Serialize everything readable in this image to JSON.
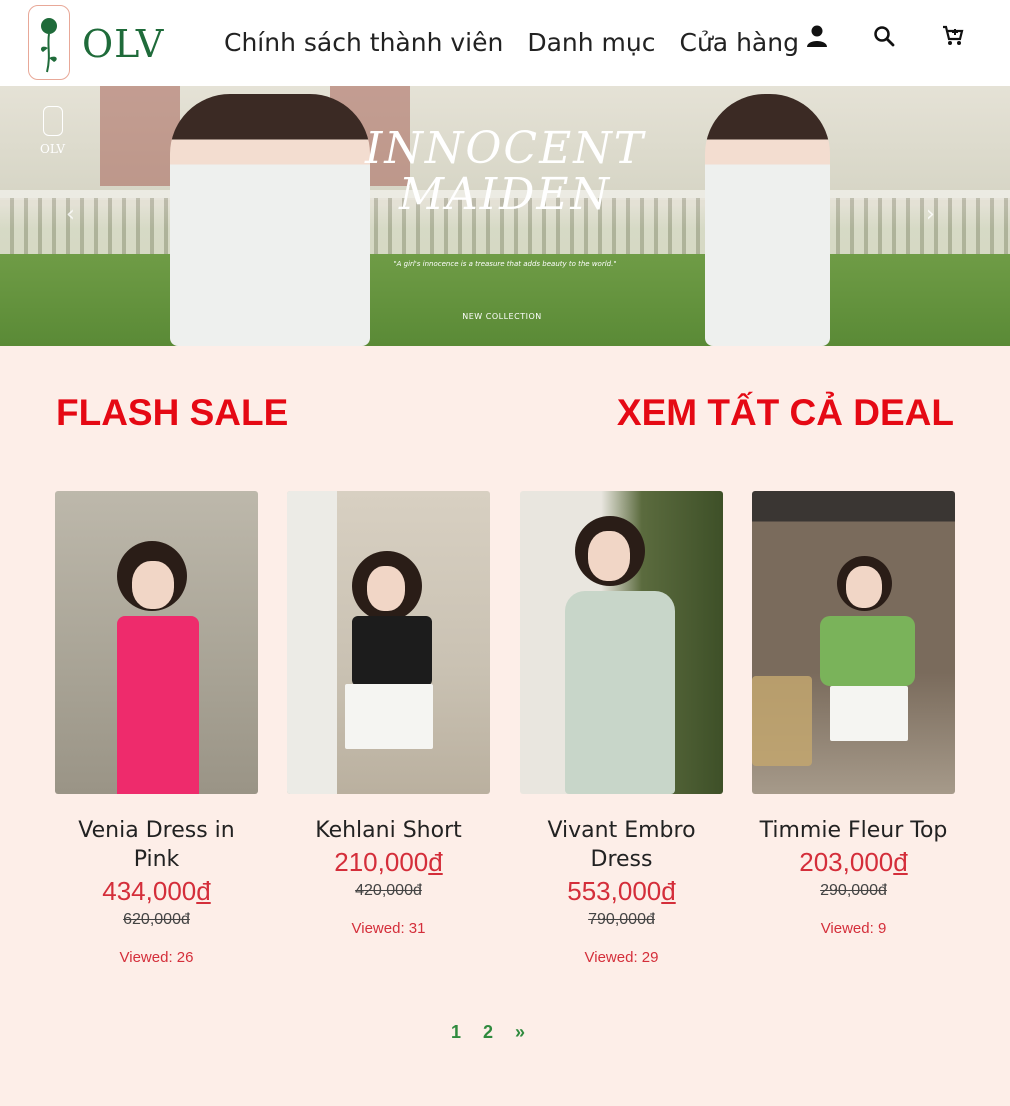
{
  "header": {
    "logo_text": "OLV",
    "nav": [
      {
        "label": "Chính sách thành viên"
      },
      {
        "label": "Danh mục"
      },
      {
        "label": "Cửa hàng"
      }
    ],
    "icons": [
      "user-icon",
      "search-icon",
      "cart-icon"
    ]
  },
  "banner": {
    "title_line1": "INNOCENT",
    "title_line2": "MAIDEN",
    "quote": "\"A girl's innocence is a treasure that adds beauty to the world.\"",
    "cta": "NEW COLLECTION",
    "logo": "OLV"
  },
  "flash_sale": {
    "title": "FLASH SALE",
    "see_all": "XEM TẤT CẢ DEAL"
  },
  "products": [
    {
      "name": "Venia Dress in Pink",
      "price": "434,000",
      "currency": "đ",
      "old_price": "620,000",
      "old_currency": "đ",
      "views": "Viewed: 26",
      "color": "#ee2b6c"
    },
    {
      "name": "Kehlani Short",
      "price": "210,000",
      "currency": "đ",
      "old_price": "420,000",
      "old_currency": "đ",
      "views": "Viewed: 31",
      "color": "#f5f5f2"
    },
    {
      "name": "Vivant Embro Dress",
      "price": "553,000",
      "currency": "đ",
      "old_price": "790,000",
      "old_currency": "đ",
      "views": "Viewed: 29",
      "color": "#c8d6c9"
    },
    {
      "name": "Timmie Fleur Top",
      "price": "203,000",
      "currency": "đ",
      "old_price": "290,000",
      "old_currency": "đ",
      "views": "Viewed: 9",
      "color": "#7ab35a"
    }
  ],
  "pagination": {
    "pages": [
      "1",
      "2"
    ],
    "next": "»"
  },
  "colors": {
    "accent_red": "#e50914",
    "price_red": "#d42e3a",
    "brand_green": "#1f6b3a",
    "page_bg": "#fdeee8"
  }
}
